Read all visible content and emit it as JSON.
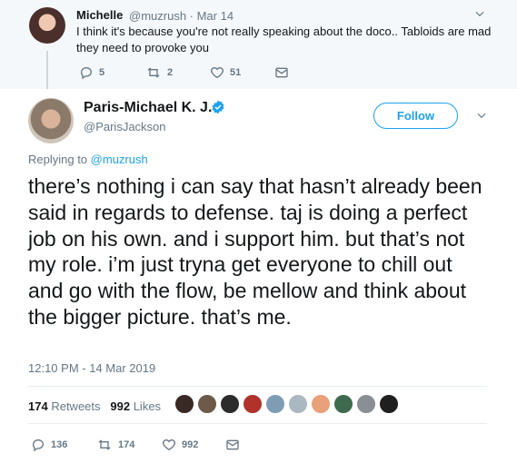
{
  "reply": {
    "display_name": "Michelle",
    "handle_time": "@muzrush · Mar 14",
    "text": "I think it's because you're not really speaking about the doco.. Tabloids are mad they need to provoke you",
    "counts": {
      "replies": "5",
      "retweets": "2",
      "likes": "51"
    }
  },
  "tweet": {
    "display_name": "Paris-Michael K. J.",
    "handle": "@ParisJackson",
    "follow_label": "Follow",
    "replying_prefix": "Replying to",
    "replying_to": "@muzrush",
    "text": "there’s nothing i can say that hasn’t already been said in regards to defense. taj is doing a perfect job on his own. and i support him. but that’s not my role. i’m just tryna get everyone to chill out and go with the flow, be mellow and think about the bigger picture. that’s me.",
    "timestamp": "12:10 PM - 14 Mar 2019",
    "retweets_count": "174",
    "retweets_label": "Retweets",
    "likes_count": "992",
    "likes_label": "Likes",
    "counts": {
      "replies": "136",
      "retweets": "174",
      "likes": "992"
    }
  },
  "liker_avatar_colors": [
    "#3a2a26",
    "#6d5a4b",
    "#2c2c2c",
    "#b0322b",
    "#7f9cb5",
    "#aab8c2",
    "#e8a17b",
    "#3e6b4e",
    "#8a8f96",
    "#1f1f1f"
  ],
  "colors": {
    "accent": "#1da1f2",
    "muted": "#657786",
    "reply_bg": "#f5f8fa"
  }
}
